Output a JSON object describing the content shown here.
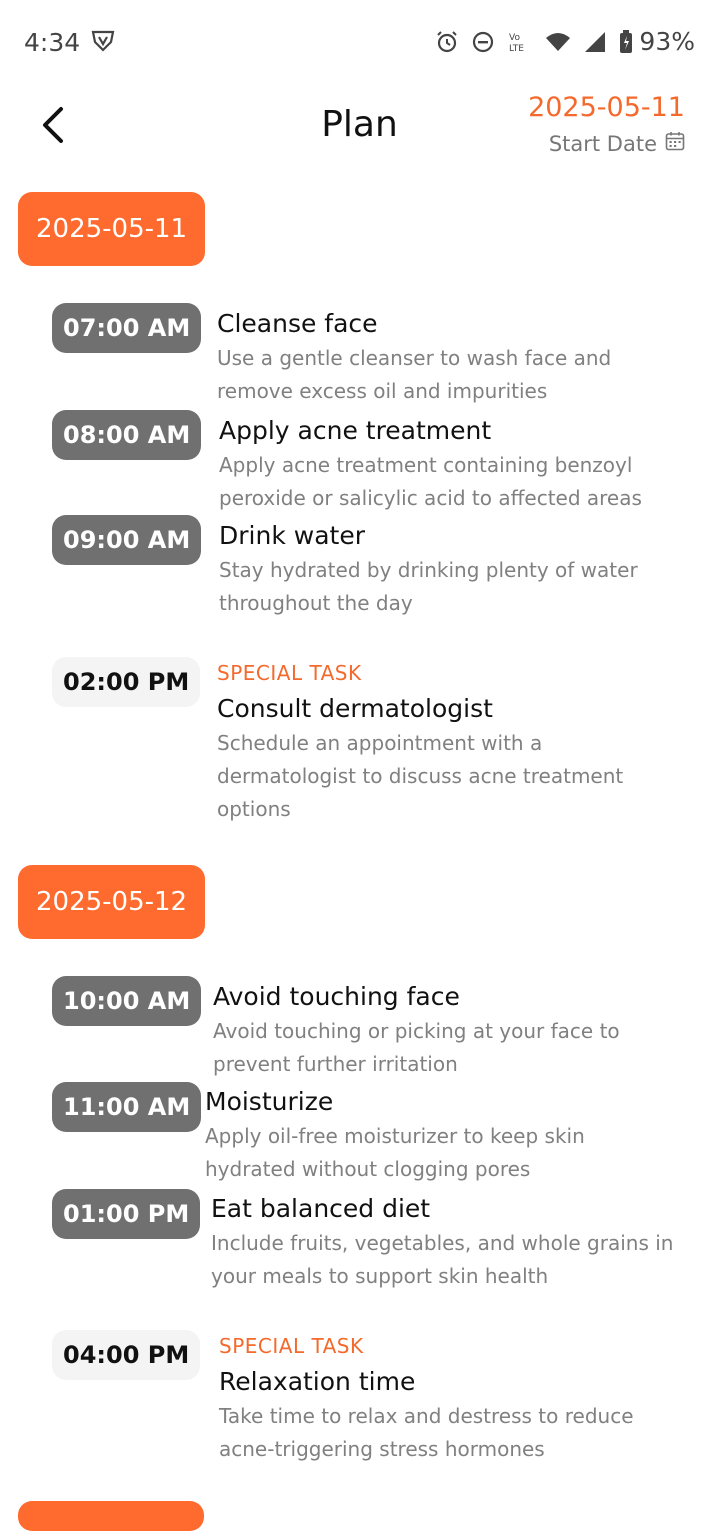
{
  "status_bar": {
    "time": "4:34",
    "battery": "93%",
    "icons": [
      "shield-v-icon",
      "alarm-icon",
      "dnd-icon",
      "volte-icon",
      "wifi-icon",
      "signal-icon",
      "battery-icon"
    ]
  },
  "header": {
    "title": "Plan",
    "start_date_value": "2025-05-11",
    "start_date_label": "Start Date",
    "accent": "#f4692c"
  },
  "days": [
    {
      "date": "2025-05-11",
      "tasks": [
        {
          "time": "07:00 AM",
          "title": "Cleanse face",
          "desc_lines": [
            "Use a gentle cleanser to wash face and",
            "remove excess oil and impurities"
          ]
        },
        {
          "time": "08:00 AM",
          "title": "Apply acne treatment",
          "desc_lines": [
            "Apply acne treatment containing benzoyl",
            "peroxide or salicylic acid to affected areas"
          ]
        },
        {
          "time": "09:00 AM",
          "title": "Drink water",
          "desc_lines": [
            "Stay hydrated by drinking plenty of water",
            "throughout the day"
          ]
        },
        {
          "time": "02:00 PM",
          "special_label": "SPECIAL TASK",
          "title": "Consult dermatologist",
          "desc_lines": [
            "Schedule an appointment with a",
            "dermatologist to discuss acne treatment",
            "options"
          ]
        }
      ]
    },
    {
      "date": "2025-05-12",
      "tasks": [
        {
          "time": "10:00 AM",
          "title": "Avoid touching face",
          "desc_lines": [
            "Avoid touching or picking at your face to",
            "prevent further irritation"
          ]
        },
        {
          "time": "11:00 AM",
          "title": "Moisturize",
          "desc_lines": [
            "Apply oil-free moisturizer to keep skin",
            "hydrated without clogging pores"
          ]
        },
        {
          "time": "01:00 PM",
          "title": "Eat balanced diet",
          "desc_lines": [
            "Include fruits, vegetables, and whole grains in",
            "your meals to support skin health"
          ]
        },
        {
          "time": "04:00 PM",
          "special_label": "SPECIAL TASK",
          "title": "Relaxation time",
          "desc_lines": [
            "Take time to relax and destress to reduce",
            "acne-triggering stress hormones"
          ]
        }
      ]
    }
  ]
}
